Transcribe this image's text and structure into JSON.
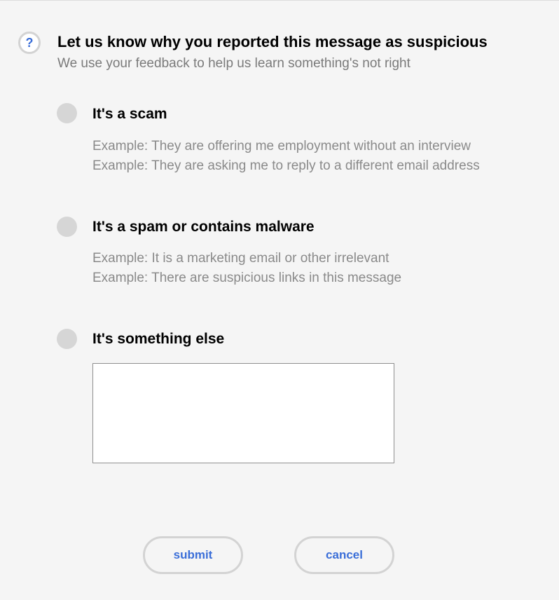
{
  "header": {
    "icon": "question-mark-icon",
    "icon_glyph": "?",
    "title": "Let us know why you reported this message as suspicious",
    "subtitle": "We use your feedback to help us learn something's not right"
  },
  "options": [
    {
      "label": "It's a scam",
      "examples": [
        "Example: They are offering me employment without an interview",
        "Example: They are asking me to reply to a different email address"
      ]
    },
    {
      "label": "It's a spam or contains malware",
      "examples": [
        "Example: It is a marketing email or other irrelevant",
        "Example: There are suspicious links in this message"
      ]
    },
    {
      "label": "It's something else",
      "textarea_value": ""
    }
  ],
  "actions": {
    "submit_label": "submit",
    "cancel_label": "cancel"
  },
  "colors": {
    "background": "#f5f5f5",
    "accent": "#3a6ed8",
    "muted_text": "#8a8a8a",
    "radio_fill": "#d6d6d6"
  }
}
